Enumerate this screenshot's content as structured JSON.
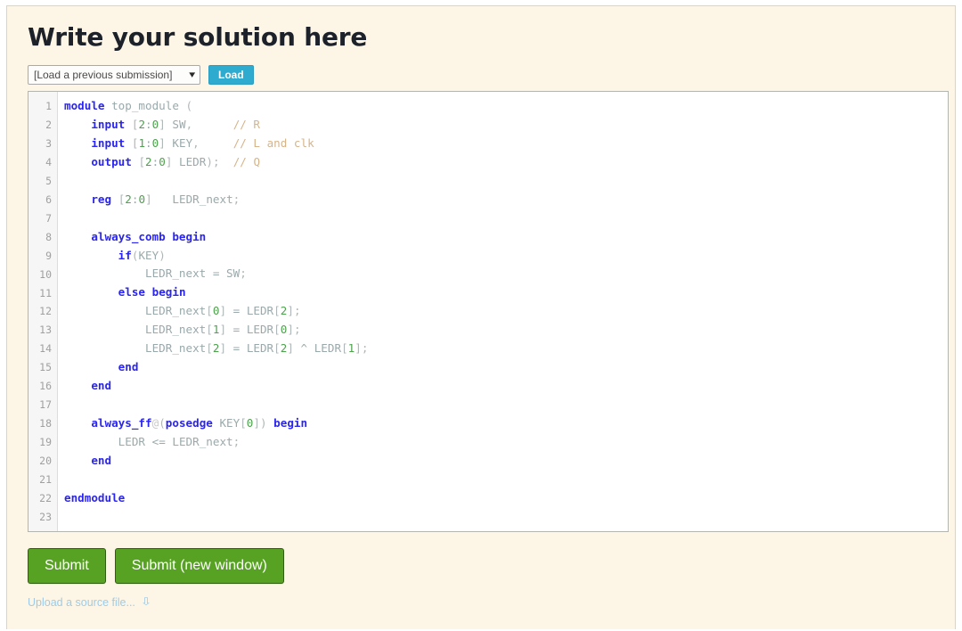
{
  "page": {
    "title": "Write your solution here"
  },
  "toolbar": {
    "select_value": "[Load a previous submission]",
    "select_caret_icon": "chevron-down-icon",
    "load_label": "Load"
  },
  "editor": {
    "line_numbers": [
      "1",
      "2",
      "3",
      "4",
      "5",
      "6",
      "7",
      "8",
      "9",
      "10",
      "11",
      "12",
      "13",
      "14",
      "15",
      "16",
      "17",
      "18",
      "19",
      "20",
      "21",
      "22",
      "23"
    ],
    "lines": [
      "module top_module (",
      "    input [2:0] SW,      // R",
      "    input [1:0] KEY,     // L and clk",
      "    output [2:0] LEDR);  // Q",
      "",
      "    reg [2:0]   LEDR_next;",
      "",
      "    always_comb begin",
      "        if(KEY)",
      "            LEDR_next = SW;",
      "        else begin",
      "            LEDR_next[0] = LEDR[2];",
      "            LEDR_next[1] = LEDR[0];",
      "            LEDR_next[2] = LEDR[2] ^ LEDR[1];",
      "        end",
      "    end",
      "",
      "    always_ff@(posedge KEY[0]) begin",
      "        LEDR <= LEDR_next;",
      "    end",
      "",
      "endmodule",
      ""
    ]
  },
  "actions": {
    "submit_label": "Submit",
    "submit_new_window_label": "Submit (new window)",
    "upload_label": "Upload a source file...",
    "upload_expand_icon": "double-chevron-down-icon"
  },
  "colors": {
    "panel_bg": "#fdf6e6",
    "accent_load": "#2fabd0",
    "accent_submit": "#57a223",
    "keyword": "#2b25f0",
    "number": "#4ea24e",
    "comment": "#d6b48a",
    "identifier": "#9aa9ab",
    "link": "#9ecbe8"
  }
}
